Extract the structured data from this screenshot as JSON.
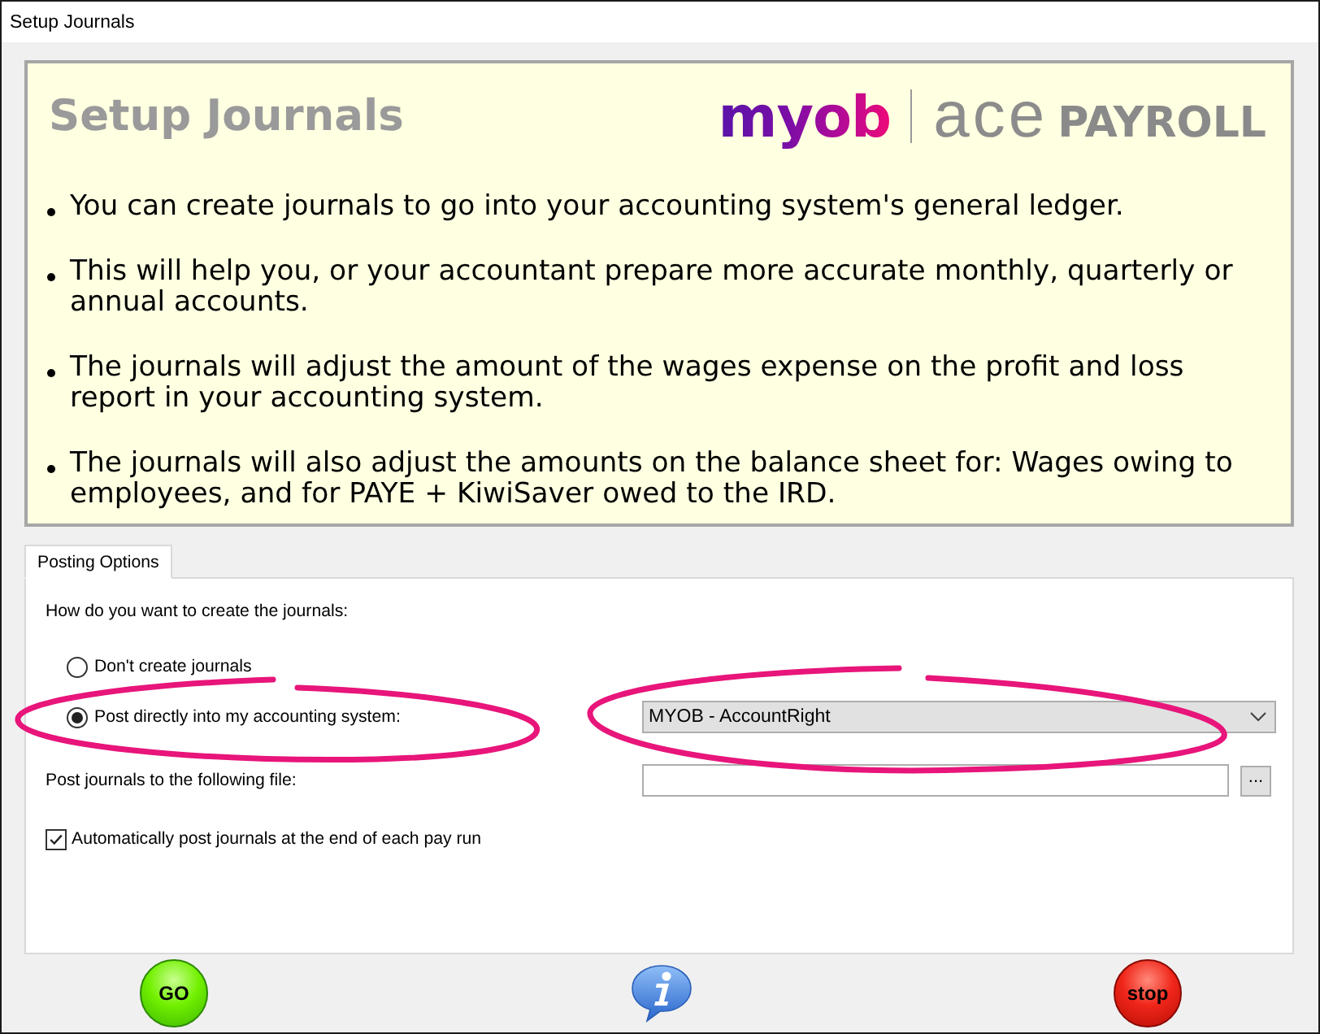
{
  "window": {
    "title": "Setup Journals"
  },
  "header": {
    "title": "Setup Journals",
    "logo": {
      "wordmark": "myob",
      "product_light": "ace",
      "product_bold": "PAYROLL"
    }
  },
  "bullets": [
    "You can create journals to go into your accounting system's general ledger.",
    "This will help you, or your accountant prepare more accurate monthly, quarterly or annual accounts.",
    "The journals will adjust the amount of the wages expense on the profit and loss report in your accounting system.",
    "The journals will also adjust the amounts on the balance sheet for: Wages owing to employees, and for PAYE + KiwiSaver owed to the IRD."
  ],
  "tabs": [
    {
      "label": "Posting Options",
      "selected": true
    }
  ],
  "posting_options": {
    "question": "How do you want to create the journals:",
    "choices": [
      {
        "label": "Don't create journals",
        "selected": false
      },
      {
        "label": "Post directly into my accounting system:",
        "selected": true
      }
    ],
    "system_dropdown": {
      "value": "MYOB - AccountRight"
    },
    "file_label": "Post journals to the following file:",
    "browse_button": "...",
    "auto_post": {
      "label": "Automatically post journals at the end of each pay run",
      "checked": true
    }
  },
  "footer_buttons": [
    {
      "kind": "go",
      "label": "GO"
    },
    {
      "kind": "info"
    },
    {
      "kind": "stop",
      "label": "stop"
    }
  ]
}
